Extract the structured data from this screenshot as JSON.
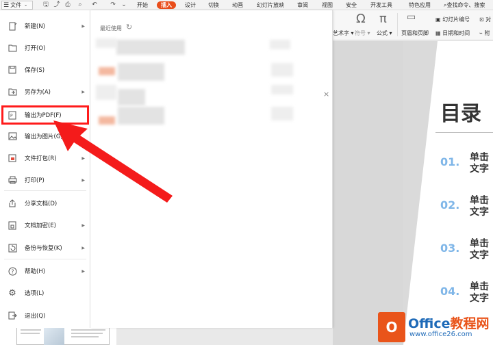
{
  "toolbar": {
    "file_label": "文件",
    "tabs": [
      "开始",
      "插入",
      "设计",
      "切换",
      "动画",
      "幻灯片放映",
      "审阅",
      "视图",
      "安全",
      "开发工具",
      "特色应用"
    ],
    "active_tab": "插入",
    "search_text": "查找命令、搜索"
  },
  "ribbon": {
    "arttext": "艺术字",
    "symbol": "符号",
    "formula": "公式",
    "header_footer": "页眉和页脚",
    "slide_number": "幻灯片编号",
    "datetime": "日期和时间",
    "obj": "对",
    "attach": "附"
  },
  "menu": {
    "items": [
      {
        "label": "新建(N)",
        "icon": "new-file-icon",
        "arrow": true
      },
      {
        "label": "打开(O)",
        "icon": "folder-icon",
        "arrow": false
      },
      {
        "label": "保存(S)",
        "icon": "save-icon",
        "arrow": false
      },
      {
        "label": "另存为(A)",
        "icon": "save-as-icon",
        "arrow": true
      },
      {
        "label": "输出为PDF(F)",
        "icon": "pdf-icon",
        "arrow": false
      },
      {
        "label": "输出为图片(G)",
        "icon": "image-icon",
        "arrow": false
      },
      {
        "label": "文件打包(R)",
        "icon": "package-icon",
        "arrow": true
      },
      {
        "label": "打印(P)",
        "icon": "print-icon",
        "arrow": true
      },
      {
        "label": "分享文档(D)",
        "icon": "share-icon",
        "arrow": false
      },
      {
        "label": "文档加密(E)",
        "icon": "lock-icon",
        "arrow": true
      },
      {
        "label": "备份与恢复(K)",
        "icon": "backup-icon",
        "arrow": true
      },
      {
        "label": "帮助(H)",
        "icon": "help-icon",
        "arrow": true
      },
      {
        "label": "选项(L)",
        "icon": "gear-icon",
        "arrow": false
      },
      {
        "label": "退出(Q)",
        "icon": "exit-icon",
        "arrow": false
      }
    ]
  },
  "recent": {
    "title": "最近使用"
  },
  "slide": {
    "title": "目录",
    "entries": [
      {
        "num": "01.",
        "line1": "单击",
        "line2": "文字"
      },
      {
        "num": "02.",
        "line1": "单击",
        "line2": "文字"
      },
      {
        "num": "03.",
        "line1": "单击",
        "line2": "文字"
      },
      {
        "num": "04.",
        "line1": "单击",
        "line2": "文字"
      }
    ]
  },
  "watermark": {
    "name_en": "Office",
    "name_cn": "教程网",
    "url": "www.office26.com"
  },
  "colors": {
    "accent": "#e94e1b",
    "highlight": "#ff1b1b",
    "toc_number": "#7fb6e8"
  }
}
